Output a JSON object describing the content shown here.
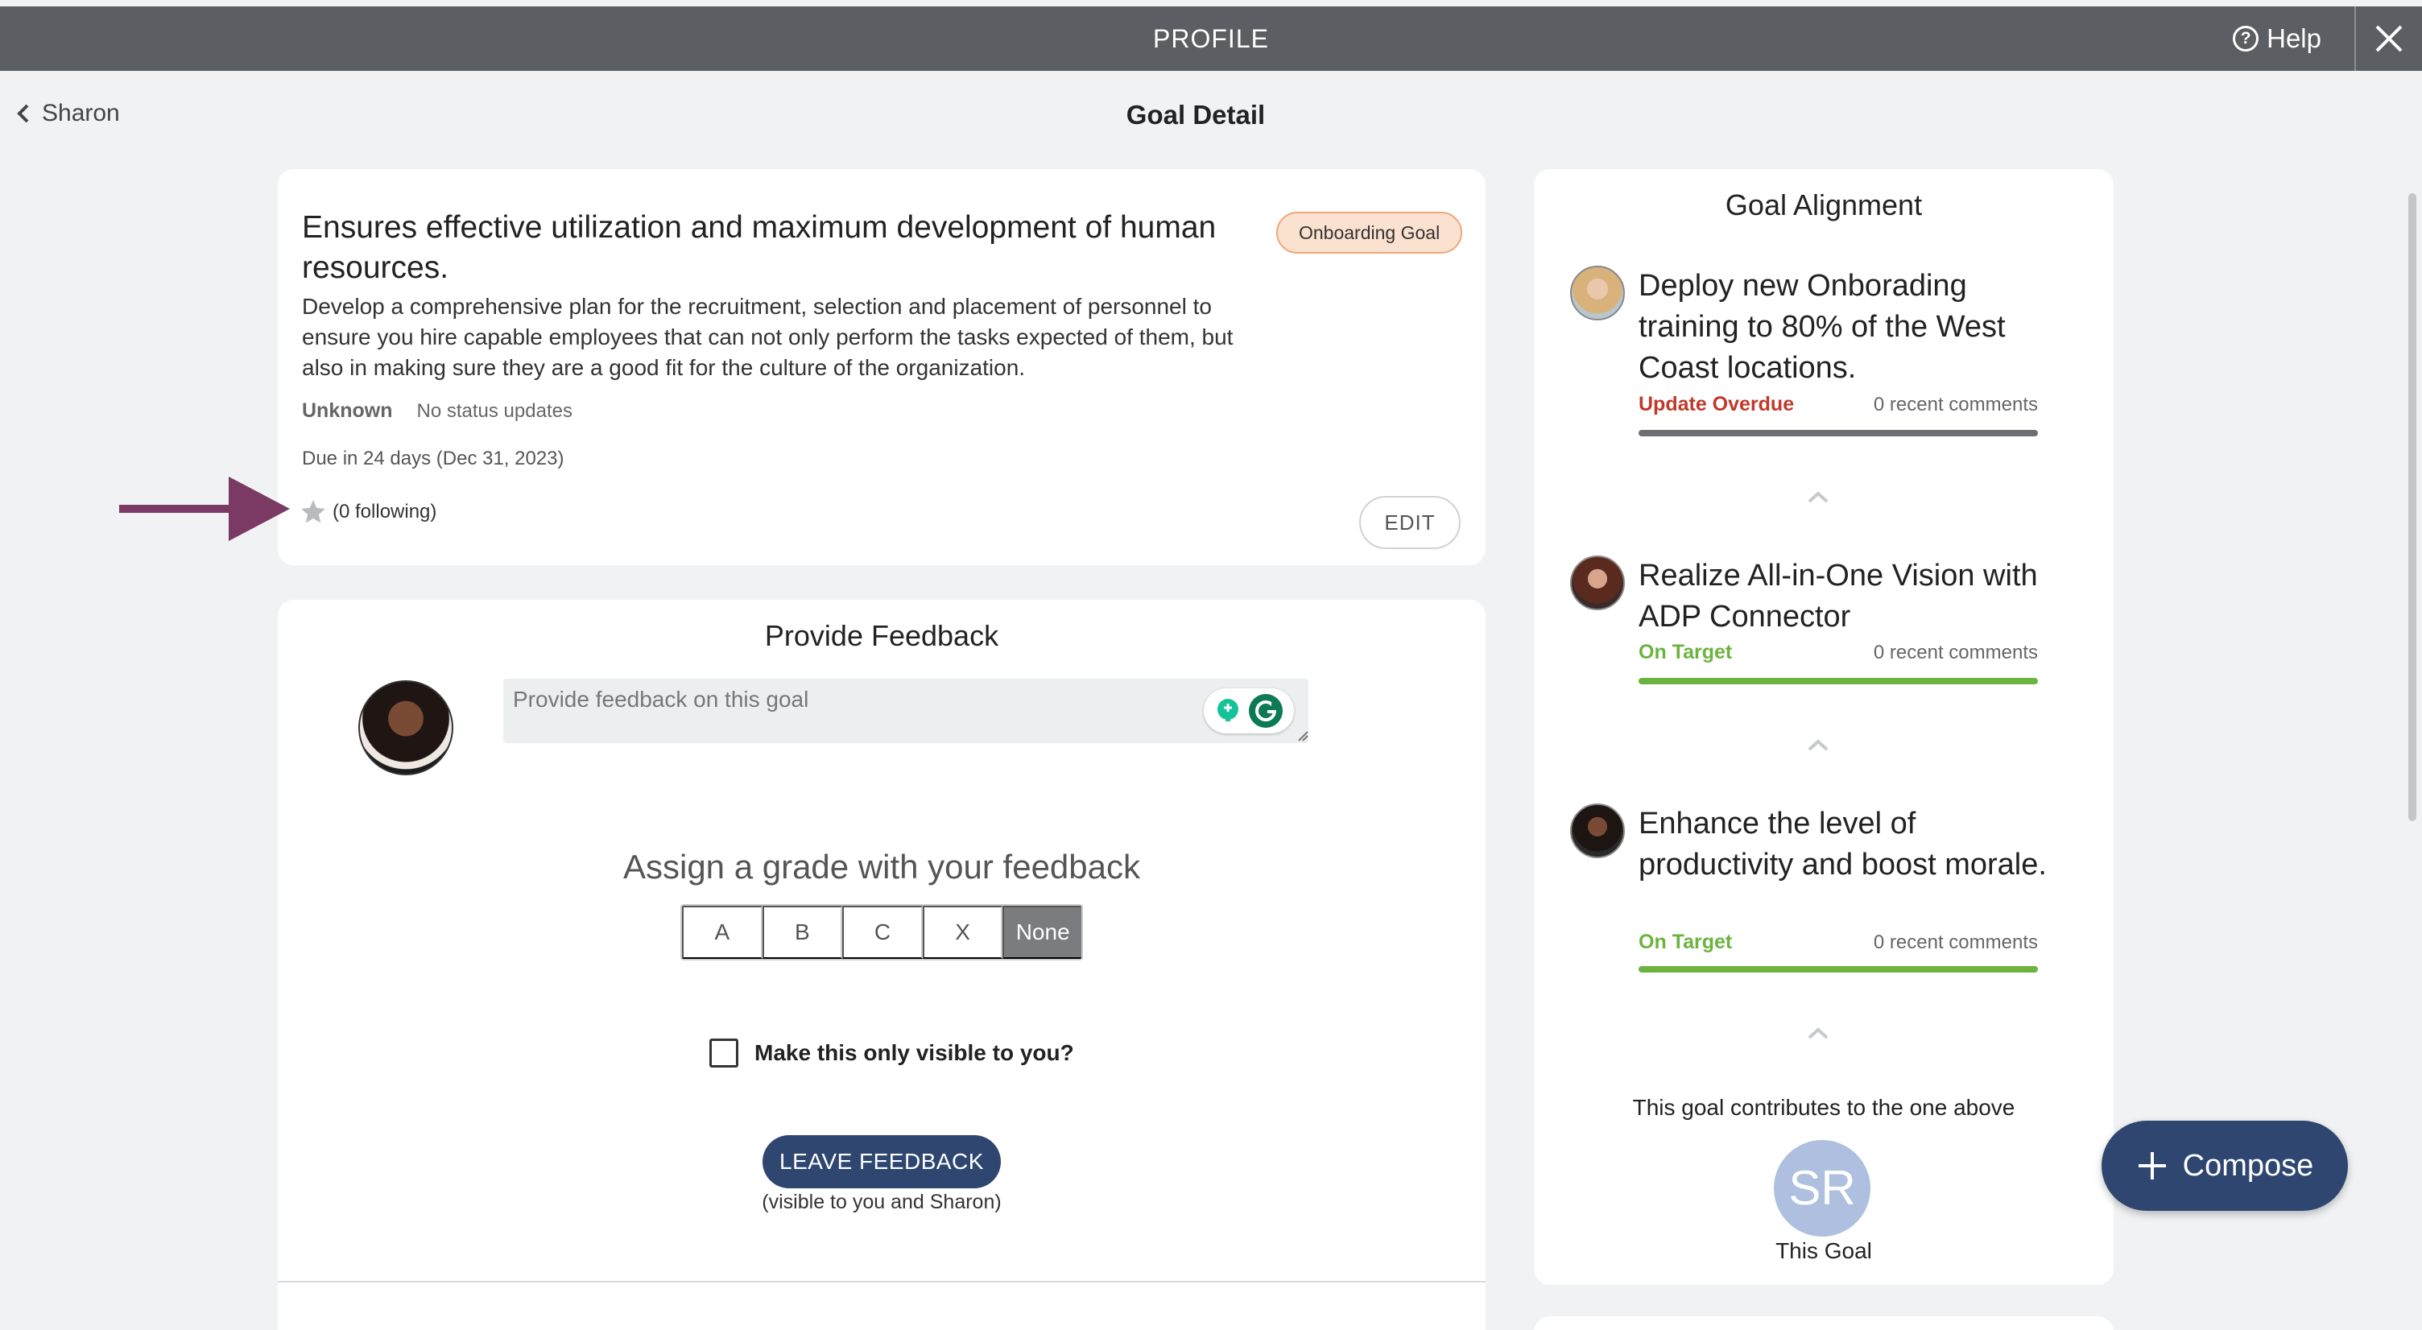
{
  "topbar": {
    "title": "PROFILE",
    "help_label": "Help",
    "help_icon": "question-circle-icon",
    "close_icon": "close-icon"
  },
  "nav": {
    "back_label": "Sharon",
    "page_title": "Goal Detail"
  },
  "goal": {
    "title": "Ensures effective utilization and maximum development of human resources.",
    "badge": "Onboarding Goal",
    "description": "Develop a comprehensive plan for the recruitment, selection and placement of personnel to ensure you hire capable employees that can not only perform the tasks expected of them, but also in making sure they are a good fit for the culture of the organization.",
    "status": "Unknown",
    "status_updates": "No status updates",
    "due": "Due in 24 days (Dec 31, 2023)",
    "following": "(0 following)",
    "edit_label": "EDIT"
  },
  "feedback": {
    "title": "Provide Feedback",
    "placeholder": "Provide feedback on this goal",
    "grade_title": "Assign a grade with your feedback",
    "grades": [
      "A",
      "B",
      "C",
      "X",
      "None"
    ],
    "selected_grade": "None",
    "private_label": "Make this only visible to you?",
    "private_checked": false,
    "submit_label": "LEAVE FEEDBACK",
    "visibility_note": "(visible to you and Sharon)"
  },
  "alignment": {
    "title": "Goal Alignment",
    "items": [
      {
        "text": "Deploy new Onborading training to 80% of the West Coast locations.",
        "status": "Update Overdue",
        "status_color": "#c0392b",
        "comments": "0 recent comments",
        "bar_color": "#6b6e72"
      },
      {
        "text": "Realize All-in-One Vision with ADP Connector",
        "status": "On Target",
        "status_color": "#6cb33f",
        "comments": "0 recent comments",
        "bar_color": "#6cb33f"
      },
      {
        "text": "Enhance the level of productivity and boost morale.",
        "status": "On Target",
        "status_color": "#6cb33f",
        "comments": "0 recent comments",
        "bar_color": "#6cb33f"
      }
    ],
    "contributes_note": "This goal contributes to the one above",
    "this_goal_initials": "SR",
    "this_goal_label": "This Goal"
  },
  "compose": {
    "label": "Compose"
  },
  "colors": {
    "topbar": "#5b5e62",
    "primary": "#2e4670",
    "annotation_arrow": "#7b3a63"
  }
}
